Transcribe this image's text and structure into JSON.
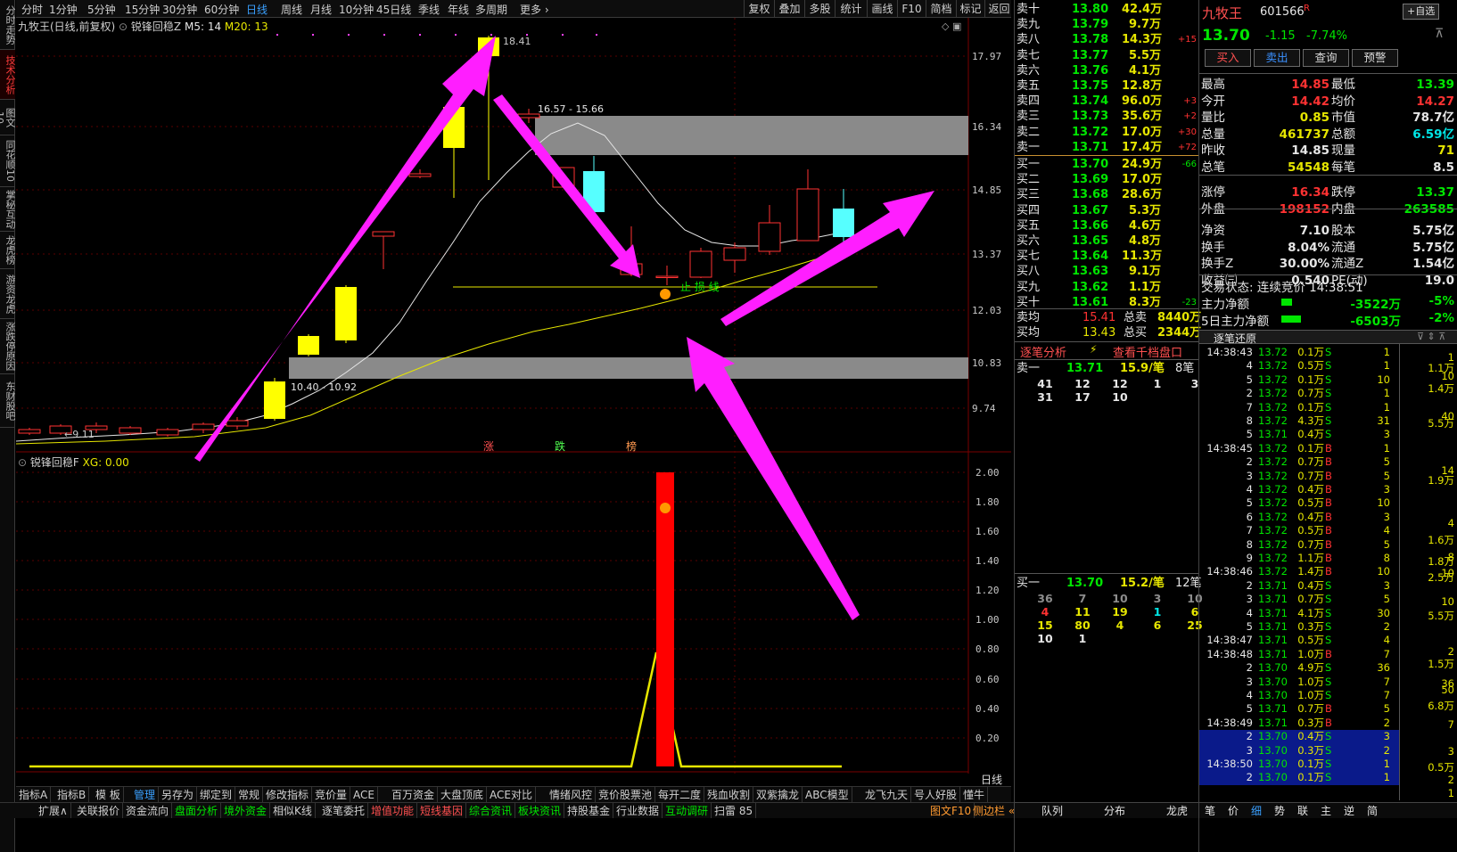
{
  "left_sidebar": [
    "分时走势",
    "技术分析",
    "图文10",
    "同花顺10",
    "掌秘互动",
    "龙虎榜",
    "游资龙虎",
    "涨跌停原因",
    "东财股吧"
  ],
  "periods": [
    "分时",
    "1分钟",
    "5分钟",
    "15分钟",
    "30分钟",
    "60分钟",
    "日线",
    "周线",
    "月线",
    "10分钟",
    "45日线",
    "季线",
    "年线",
    "多周期",
    "更多 ›"
  ],
  "active_period": "日线",
  "right_tools": [
    "复权",
    "叠加",
    "多股",
    "统计",
    "画线",
    "F10",
    "简档",
    "标记",
    "返回"
  ],
  "chart": {
    "title": "九牧王(日线,前复权)",
    "indicator": "锐锋回稳Z",
    "m5": "M5: 14",
    "m20": "M20: 13",
    "high_label": "18.41",
    "range_top": "16.57 - 15.66",
    "range_bottom": "10.40 - 10.92",
    "low_label": "←9.11",
    "support_label": "止 损 线",
    "y_labels": [
      "17.97",
      "16.34",
      "14.85",
      "13.37",
      "12.03",
      "10.83",
      "9.74"
    ],
    "markers": [
      "涨",
      "跌",
      "榜"
    ],
    "sub_title": "锐锋回稳F",
    "sub_xg": "XG: 0.00",
    "sub_y": [
      "2.00",
      "1.80",
      "1.60",
      "1.40",
      "1.20",
      "1.00",
      "0.80",
      "0.60",
      "0.40",
      "0.20"
    ],
    "x_labels": [
      "2025年",
      "12"
    ],
    "period_badge": "日线"
  },
  "bottom_tabs1": [
    "指标A",
    "指标B",
    "模 板",
    "管理",
    "另存为",
    "绑定到",
    "常规",
    "修改指标",
    "竞价量",
    "ACE",
    "百万资金",
    "大盘顶底",
    "ACE对比",
    "情绪风控",
    "竞价股票池",
    "每开二度",
    "残血收割",
    "双紫擒龙",
    "ABC模型",
    "龙飞九天",
    "号人好股",
    "懂牛"
  ],
  "bottom_tabs2": [
    "扩展∧",
    "关联报价",
    "资金流向",
    "盘面分析",
    "境外资金",
    "相似K线",
    "逐笔委托",
    "增值功能",
    "短线基因",
    "综合资讯",
    "板块资讯",
    "持股基金",
    "行业数据",
    "互动调研",
    "扫雷 85"
  ],
  "bottom_right": [
    "图文F10",
    "侧边栏 «"
  ],
  "orderbook": {
    "asks": [
      [
        "卖十",
        "13.80",
        "42.4万",
        ""
      ],
      [
        "卖九",
        "13.79",
        "9.7万",
        ""
      ],
      [
        "卖八",
        "13.78",
        "14.3万",
        "+15"
      ],
      [
        "卖七",
        "13.77",
        "5.5万",
        ""
      ],
      [
        "卖六",
        "13.76",
        "4.1万",
        ""
      ],
      [
        "卖五",
        "13.75",
        "12.8万",
        ""
      ],
      [
        "卖四",
        "13.74",
        "96.0万",
        "+3"
      ],
      [
        "卖三",
        "13.73",
        "35.6万",
        "+2"
      ],
      [
        "卖二",
        "13.72",
        "17.0万",
        "+30"
      ],
      [
        "卖一",
        "13.71",
        "17.4万",
        "+72"
      ]
    ],
    "bids": [
      [
        "买一",
        "13.70",
        "24.9万",
        "-66"
      ],
      [
        "买二",
        "13.69",
        "17.0万",
        ""
      ],
      [
        "买三",
        "13.68",
        "28.6万",
        ""
      ],
      [
        "买四",
        "13.67",
        "5.3万",
        ""
      ],
      [
        "买五",
        "13.66",
        "4.6万",
        ""
      ],
      [
        "买六",
        "13.65",
        "4.8万",
        ""
      ],
      [
        "买七",
        "13.64",
        "11.3万",
        ""
      ],
      [
        "买八",
        "13.63",
        "9.1万",
        ""
      ],
      [
        "买九",
        "13.62",
        "1.1万",
        ""
      ],
      [
        "买十",
        "13.61",
        "8.3万",
        "-23"
      ]
    ],
    "avg": [
      [
        "卖均",
        "15.41",
        "总卖",
        "8440万"
      ],
      [
        "买均",
        "13.43",
        "总买",
        "2344万"
      ]
    ],
    "tabs": [
      "逐笔分析",
      "查看千档盘口"
    ],
    "ask1": {
      "label": "卖一",
      "price": "13.71",
      "vol": "15.9/笔",
      "count": "8笔",
      "q": [
        [
          "41",
          "12",
          "12",
          "1",
          "3"
        ],
        [
          "31",
          "17",
          "10",
          "",
          ""
        ]
      ]
    },
    "bid1": {
      "label": "买一",
      "price": "13.70",
      "vol": "15.2/笔",
      "count": "12笔",
      "q": [
        [
          "36",
          "7",
          "10",
          "3",
          "10"
        ],
        [
          "4",
          "11",
          "19",
          "1",
          "6"
        ],
        [
          "15",
          "80",
          "4",
          "6",
          "25"
        ],
        [
          "10",
          "1",
          "",
          "",
          ""
        ]
      ]
    },
    "bottom": [
      "队列",
      "分布",
      "龙虎"
    ]
  },
  "info": {
    "name": "九牧王",
    "code": "601566",
    "r": "R",
    "btn_self": "+自选",
    "price": "13.70",
    "chg": "-1.15",
    "pct": "-7.74%",
    "buttons": [
      "买入",
      "卖出",
      "查询",
      "预警"
    ],
    "rows": [
      [
        "最高",
        "14.85",
        "最低",
        "13.39"
      ],
      [
        "今开",
        "14.42",
        "均价",
        "14.27"
      ],
      [
        "量比",
        "0.85",
        "市值",
        "78.7亿"
      ],
      [
        "总量",
        "461737",
        "总额",
        "6.59亿"
      ],
      [
        "昨收",
        "14.85",
        "现量",
        "71"
      ],
      [
        "总笔",
        "54548",
        "每笔",
        "8.5"
      ],
      [
        "涨停",
        "16.34",
        "跌停",
        "13.37"
      ],
      [
        "外盘",
        "198152",
        "内盘",
        "263585"
      ],
      [
        "净资",
        "7.10",
        "股本",
        "5.75亿"
      ],
      [
        "换手",
        "8.04%",
        "流通",
        "5.75亿"
      ],
      [
        "换手Z",
        "30.00%",
        "流通Z",
        "1.54亿"
      ],
      [
        "收益㈢",
        "0.540",
        "PE(动)",
        "19.0"
      ]
    ],
    "status": "交易状态: 连续竞价 14:38:51",
    "flow": [
      [
        "主力净额",
        "-3522万",
        "-5%"
      ],
      [
        "5日主力净额",
        "-6503万",
        "-2%"
      ]
    ],
    "ticks_title": "逐笔还原",
    "ticks": [
      [
        "14:38:43",
        "13.72",
        "0.1万",
        "S",
        "1",
        "",
        ""
      ],
      [
        "4",
        "13.72",
        "0.5万",
        "S",
        "1",
        "1.1万",
        ""
      ],
      [
        "5",
        "13.72",
        "0.1万",
        "S",
        "10",
        "",
        ""
      ],
      [
        "2",
        "13.72",
        "0.7万",
        "S",
        "1",
        "",
        ""
      ],
      [
        "7",
        "13.72",
        "0.1万",
        "S",
        "1",
        "",
        ""
      ],
      [
        "8",
        "13.72",
        "4.3万",
        "S",
        "31",
        "5.5万",
        ""
      ],
      [
        "5",
        "13.71",
        "0.4万",
        "S",
        "3",
        "",
        ""
      ],
      [
        "14:38:45",
        "13.72",
        "0.1万",
        "B",
        "1",
        "",
        ""
      ],
      [
        "2",
        "13.72",
        "0.7万",
        "B",
        "5",
        "1万",
        ""
      ],
      [
        "3",
        "13.72",
        "0.7万",
        "B",
        "5",
        "",
        ""
      ],
      [
        "4",
        "13.72",
        "0.4万",
        "B",
        "3",
        "",
        ""
      ],
      [
        "5",
        "13.72",
        "0.5万",
        "B",
        "10",
        "",
        ""
      ],
      [
        "6",
        "13.72",
        "0.4万",
        "B",
        "3",
        "",
        ""
      ],
      [
        "7",
        "13.72",
        "0.5万",
        "B",
        "4",
        "",
        ""
      ],
      [
        "8",
        "13.72",
        "0.7万",
        "B",
        "5",
        "",
        ""
      ],
      [
        "9",
        "13.72",
        "1.1万",
        "B",
        "8",
        "",
        ""
      ],
      [
        "14:38:46",
        "13.72",
        "1.4万",
        "B",
        "10",
        "",
        ""
      ],
      [
        "2",
        "13.71",
        "0.4万",
        "S",
        "3",
        "",
        ""
      ],
      [
        "3",
        "13.71",
        "0.7万",
        "S",
        "5",
        "",
        ""
      ],
      [
        "4",
        "13.71",
        "4.1万",
        "S",
        "30",
        "5.5万",
        ""
      ],
      [
        "5",
        "13.71",
        "0.3万",
        "S",
        "2",
        "",
        ""
      ],
      [
        "14:38:47",
        "13.71",
        "0.5万",
        "S",
        "4",
        "",
        ""
      ],
      [
        "14:38:48",
        "13.71",
        "1.0万",
        "B",
        "7",
        "",
        ""
      ],
      [
        "2",
        "13.70",
        "4.9万",
        "S",
        "36",
        "",
        ""
      ],
      [
        "3",
        "13.70",
        "1.0万",
        "S",
        "7",
        "",
        ""
      ],
      [
        "4",
        "13.70",
        "1.0万",
        "S",
        "7",
        "",
        ""
      ],
      [
        "5",
        "13.71",
        "0.7万",
        "B",
        "5",
        "",
        ""
      ],
      [
        "14:38:49",
        "13.71",
        "0.3万",
        "B",
        "2",
        "",
        ""
      ],
      [
        "2",
        "13.70",
        "0.4万",
        "S",
        "3",
        "",
        ""
      ],
      [
        "3",
        "13.70",
        "0.3万",
        "S",
        "2",
        "",
        ""
      ],
      [
        "14:38:50",
        "13.70",
        "0.1万",
        "S",
        "1",
        "0.4万",
        ""
      ],
      [
        "2",
        "13.70",
        "0.1万",
        "S",
        "1",
        "",
        ""
      ]
    ],
    "tick_right": [
      "1",
      "1.1万",
      "10",
      "1.4万",
      "40",
      "5.5万",
      "1",
      "14",
      "5",
      "1.9万",
      "4",
      "1.6万",
      "8",
      "1.8万",
      "10",
      "2.5万",
      "10",
      "5.5万",
      "2",
      "1.5万",
      "36",
      "50",
      "6.8万",
      "7",
      "3",
      "0.5万",
      "2",
      "1"
    ],
    "bottom_tabs": [
      "笔",
      "价",
      "细",
      "势",
      "联",
      "主",
      "逆",
      "简"
    ]
  }
}
